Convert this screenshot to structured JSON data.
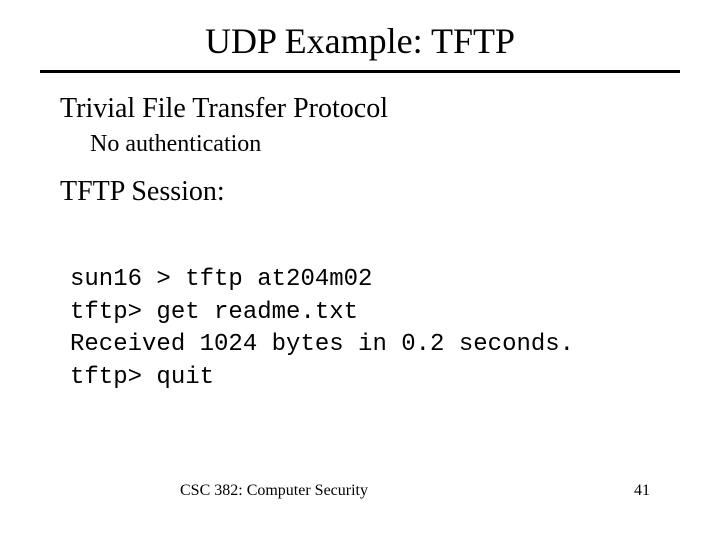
{
  "title": "UDP Example: TFTP",
  "heading": "Trivial File Transfer Protocol",
  "sub": "No authentication",
  "heading2": "TFTP Session:",
  "session": {
    "line1": "sun16 > tftp at204m02",
    "line2": "tftp> get readme.txt",
    "line3": "Received 1024 bytes in 0.2 seconds.",
    "line4": "tftp> quit"
  },
  "footer": {
    "course": "CSC 382: Computer Security",
    "page": "41"
  }
}
